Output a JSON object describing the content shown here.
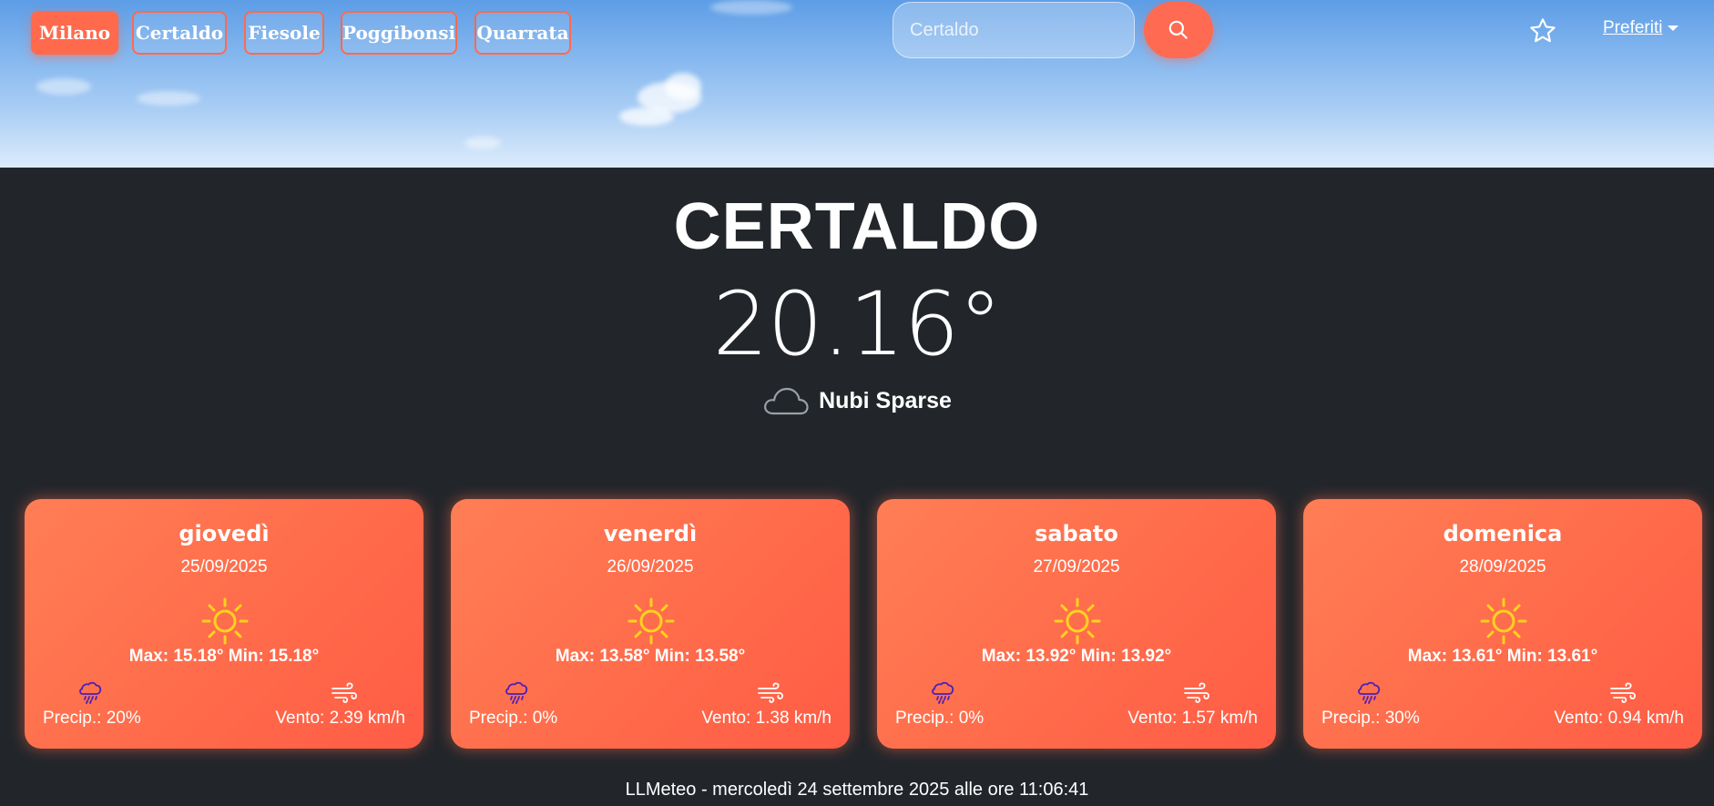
{
  "nav": {
    "cities": [
      {
        "label": "Milano",
        "active": true
      },
      {
        "label": "Certaldo",
        "active": false
      },
      {
        "label": "Fiesole",
        "active": false
      },
      {
        "label": "Poggibonsi",
        "active": false
      },
      {
        "label": "Quarrata",
        "active": false
      }
    ],
    "search_value": "Certaldo",
    "search_icon": "search-icon",
    "favorite_icon": "star-icon",
    "favorites_label": "Preferiti"
  },
  "current": {
    "city": "CERTALDO",
    "temperature": "20.16°",
    "condition": "Nubi Sparse",
    "condition_icon": "cloud-icon"
  },
  "forecast": [
    {
      "day": "giovedì",
      "date": "25/09/2025",
      "maxmin": "Max: 15.18° Min: 15.18°",
      "precip": "Precip.: 20%",
      "wind": "Vento: 2.39 km/h",
      "icon": "sun-icon"
    },
    {
      "day": "venerdì",
      "date": "26/09/2025",
      "maxmin": "Max: 13.58° Min: 13.58°",
      "precip": "Precip.: 0%",
      "wind": "Vento: 1.38 km/h",
      "icon": "sun-icon"
    },
    {
      "day": "sabato",
      "date": "27/09/2025",
      "maxmin": "Max: 13.92° Min: 13.92°",
      "precip": "Precip.: 0%",
      "wind": "Vento: 1.57 km/h",
      "icon": "sun-icon"
    },
    {
      "day": "domenica",
      "date": "28/09/2025",
      "maxmin": "Max: 13.61° Min: 13.61°",
      "precip": "Precip.: 30%",
      "wind": "Vento: 0.94 km/h",
      "icon": "sun-icon"
    }
  ],
  "footer": "LLMeteo - mercoledì 24 settembre 2025 alle ore 11:06:41",
  "colors": {
    "accent": "#ff6a4d",
    "background": "#22262b",
    "sun": "#ffd21f",
    "rain_icon": "#4b1fb8"
  }
}
